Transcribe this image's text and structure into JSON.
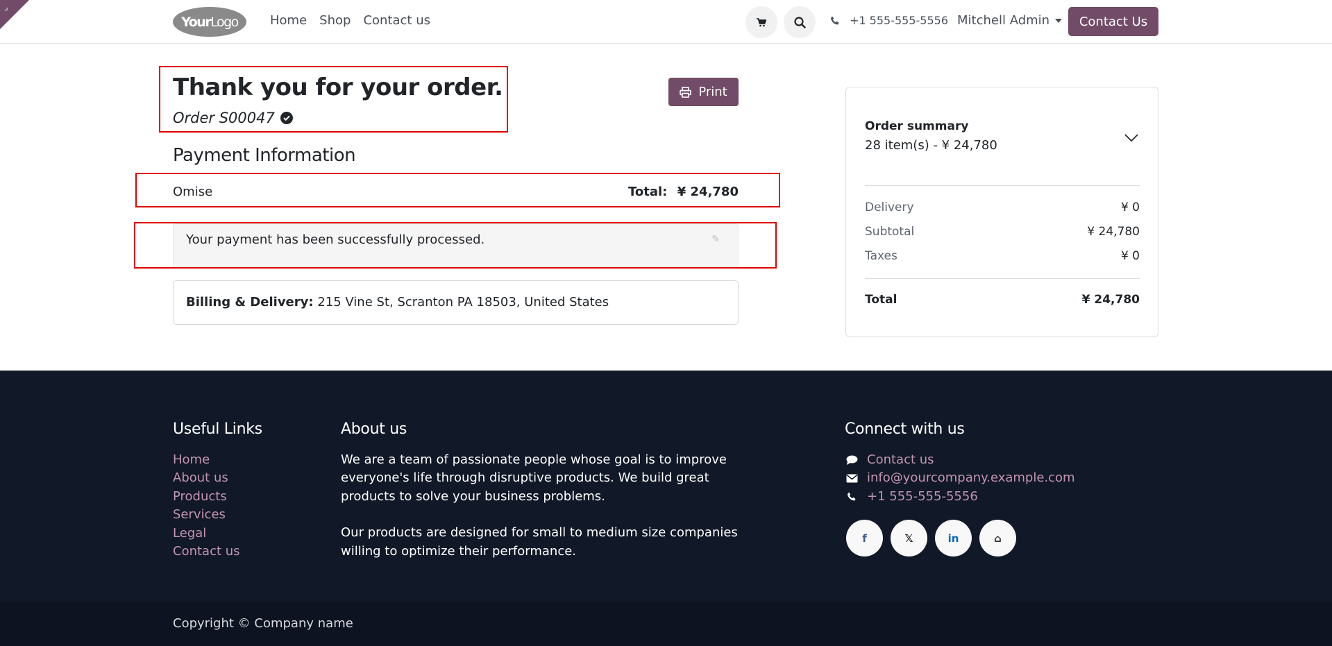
{
  "corner": {
    "glyph": "⌟"
  },
  "header": {
    "logo_bold": "Your",
    "logo_rest": "Logo",
    "nav": [
      "Home",
      "Shop",
      "Contact us"
    ],
    "phone": "+1 555-555-5556",
    "user": "Mitchell Admin",
    "cta": "Contact Us",
    "accent": "#714b67"
  },
  "order": {
    "title": "Thank you for your order.",
    "number": "Order S00047",
    "print_label": "Print",
    "payment_heading": "Payment Information",
    "payment_method": "Omise",
    "total_label": "Total:",
    "total_value": "¥ 24,780",
    "alert_text": "Your payment has been successfully processed.",
    "address_label": "Billing & Delivery:",
    "address_value": "215 Vine St, Scranton PA 18503, United States"
  },
  "summary": {
    "title": "Order summary",
    "subtitle": "28 item(s) -  ¥ 24,780",
    "lines": [
      {
        "label": "Delivery",
        "value": "¥ 0"
      },
      {
        "label": "Subtotal",
        "value": "¥ 24,780"
      },
      {
        "label": "Taxes",
        "value": "¥ 0"
      }
    ],
    "total_label": "Total",
    "total_value": "¥ 24,780"
  },
  "footer": {
    "useful_heading": "Useful Links",
    "useful_links": [
      "Home",
      "About us",
      "Products",
      "Services",
      "Legal",
      "Contact us"
    ],
    "about_heading": "About us",
    "about_p1": "We are a team of passionate people whose goal is to improve everyone's life through disruptive products. We build great products to solve your business problems.",
    "about_p2": "Our products are designed for small to medium size companies willing to optimize their performance.",
    "connect_heading": "Connect with us",
    "contact_link": "Contact us",
    "email": "info@yourcompany.example.com",
    "phone": "+1 555-555-5556",
    "socials": [
      "f",
      "𝕏",
      "in",
      "⌂"
    ],
    "copyright": "Copyright © Company name"
  }
}
